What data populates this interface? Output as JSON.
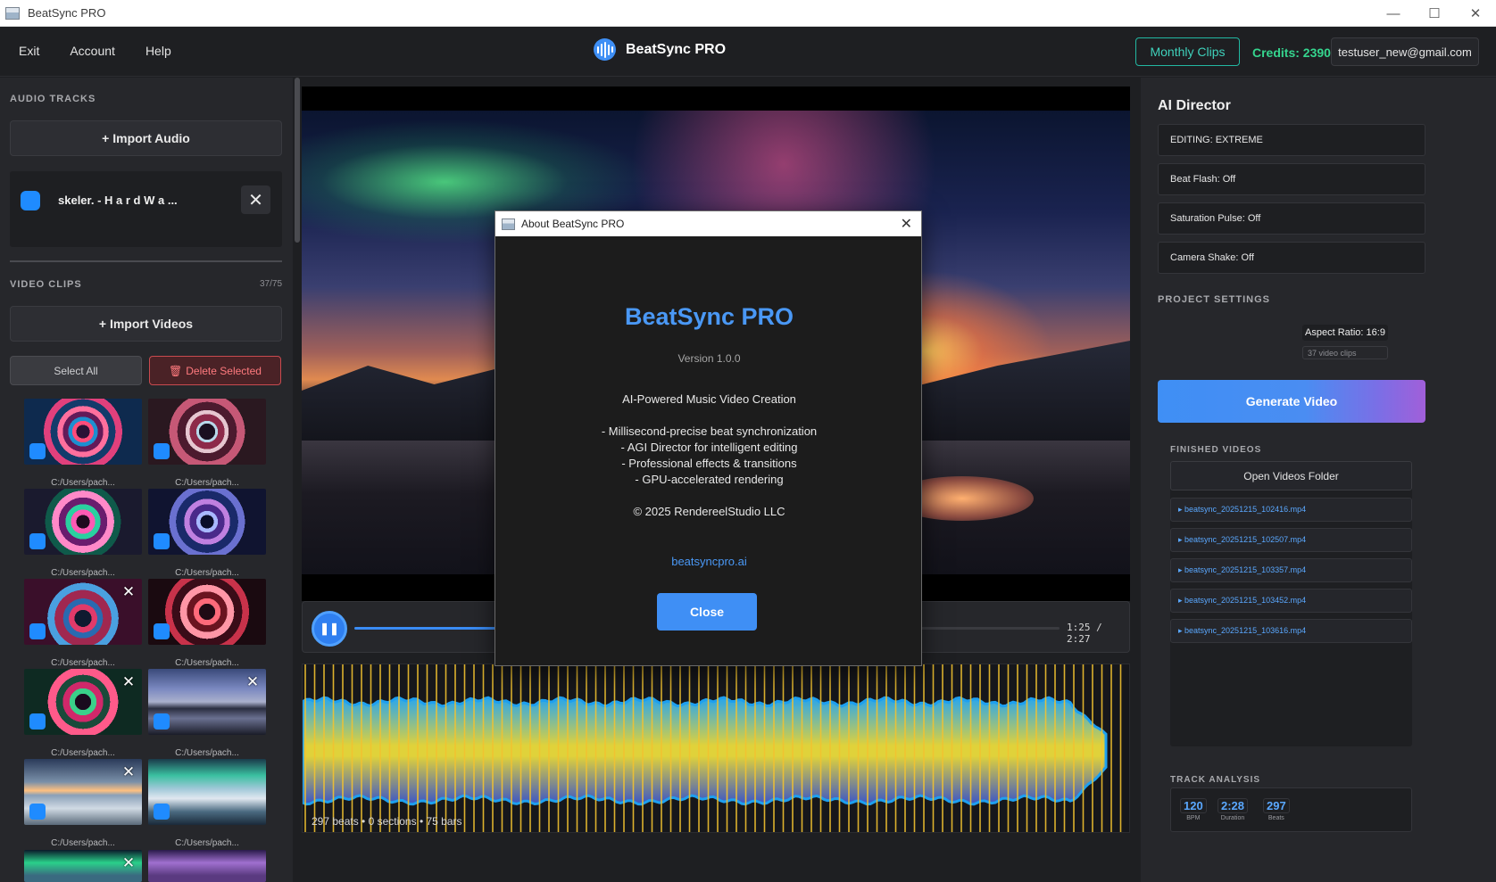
{
  "window": {
    "title": "BeatSync PRO"
  },
  "menu": {
    "items": [
      "Exit",
      "Account",
      "Help"
    ]
  },
  "header": {
    "brand": "BeatSync PRO",
    "monthly_clips": "Monthly Clips",
    "credits": "Credits: 2390",
    "user_email": "testuser_new@gmail.com"
  },
  "sidebar": {
    "audio_label": "AUDIO TRACKS",
    "import_audio": "+ Import Audio",
    "audio_track_name": "skeler. - H a r d W a ...",
    "video_label": "VIDEO CLIPS",
    "clip_count": "37/75",
    "import_videos": "+ Import Videos",
    "select_all": "Select All",
    "delete_selected": "Delete Selected",
    "clip_caption": "C:/Users/pach..."
  },
  "player": {
    "time": "1:25 / 2:27",
    "progress": 0.58,
    "wave_caption": "297 beats • 0 sections • 75 bars"
  },
  "about_dialog": {
    "window_title": "About BeatSync PRO",
    "title": "BeatSync PRO",
    "version": "Version 1.0.0",
    "tagline": "AI-Powered Music Video Creation",
    "features": [
      "- Millisecond-precise beat synchronization",
      "- AGI Director for intelligent editing",
      "- Professional effects & transitions",
      "- GPU-accelerated rendering"
    ],
    "copyright": "© 2025 RendereelStudio LLC",
    "link": "beatsyncpro.ai",
    "close": "Close"
  },
  "right_panel": {
    "title": "AI Director",
    "options": [
      "EDITING: EXTREME",
      "Beat Flash: Off",
      "Saturation Pulse: Off",
      "Camera Shake: Off"
    ],
    "project_label": "PROJECT SETTINGS",
    "aspect_ratio": "Aspect Ratio: 16:9",
    "clip_info": "37 video clips",
    "generate": "Generate Video",
    "finished_label": "FINISHED VIDEOS",
    "open_folder": "Open Videos Folder",
    "videos": [
      "▸ beatsync_20251215_102416.mp4",
      "▸ beatsync_20251215_102507.mp4",
      "▸ beatsync_20251215_103357.mp4",
      "▸ beatsync_20251215_103452.mp4",
      "▸ beatsync_20251215_103616.mp4"
    ],
    "track_label": "TRACK ANALYSIS",
    "stats": [
      {
        "value": "120",
        "label": "BPM"
      },
      {
        "value": "2:28",
        "label": "Duration"
      },
      {
        "value": "297",
        "label": "Beats"
      }
    ]
  },
  "colors": {
    "accent": "#3f8ff5",
    "credits": "#35d58e",
    "danger": "#ff7a7e",
    "teal": "#3fd1bb"
  }
}
